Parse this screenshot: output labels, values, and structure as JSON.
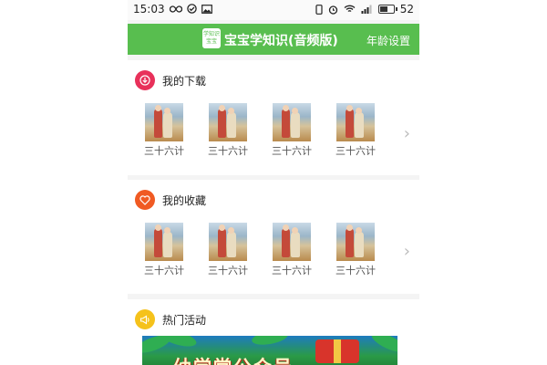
{
  "status_bar": {
    "time": "15:03",
    "battery": "52"
  },
  "app_bar": {
    "logo_line1": "学知识",
    "logo_line2": "宝宝",
    "title": "宝宝学知识(音频版)",
    "age_setting": "年龄设置",
    "color": "#58be4f"
  },
  "downloads": {
    "title": "我的下载",
    "icon": "download-icon",
    "icon_color": "#e8315a",
    "items": [
      {
        "label": "三十六计[.."
      },
      {
        "label": "三十六计[.."
      },
      {
        "label": "三十六计[.."
      },
      {
        "label": "三十六计[.."
      }
    ]
  },
  "favorites": {
    "title": "我的收藏",
    "icon": "heart-icon",
    "icon_color": "#f05a23",
    "items": [
      {
        "label": "三十六计[.."
      },
      {
        "label": "三十六计[.."
      },
      {
        "label": "三十六计[.."
      },
      {
        "label": "三十六计[.."
      }
    ]
  },
  "hot": {
    "title": "热门活动",
    "icon": "megaphone-icon",
    "icon_color": "#f5c21b",
    "banner_text": "幼学堂公众号"
  }
}
